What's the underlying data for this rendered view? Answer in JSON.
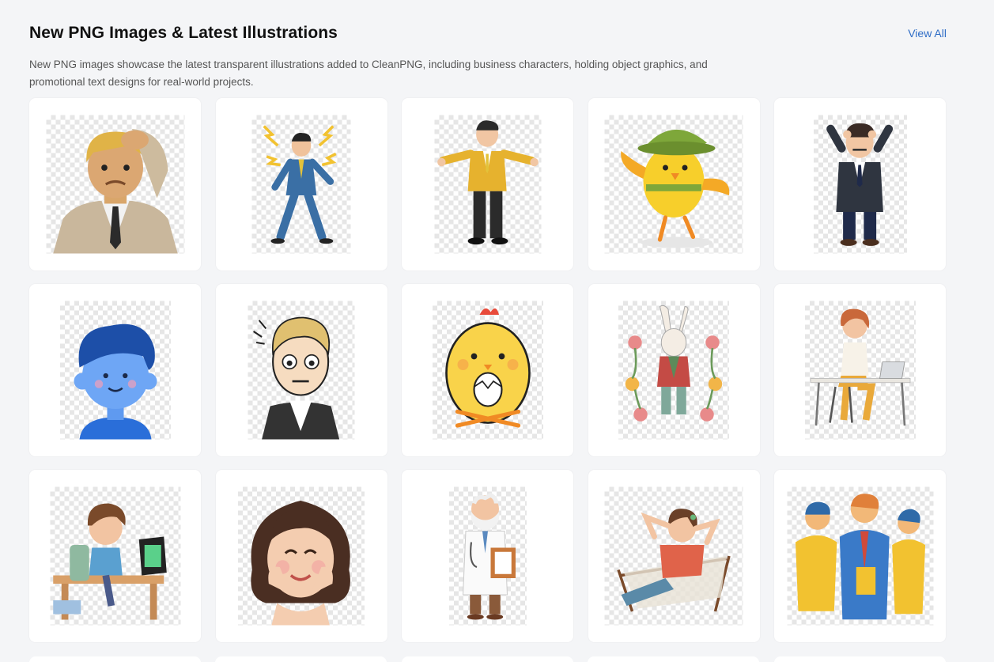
{
  "section": {
    "title": "New PNG Images & Latest Illustrations",
    "view_all_label": "View All",
    "description": "New PNG images showcase the latest transparent illustrations added to CleanPNG, including business characters, holding object graphics, and promotional text designs for real-world projects."
  },
  "images": [
    {
      "icon": "confused-businessman-3d-icon"
    },
    {
      "icon": "stressed-walking-businessman-icon"
    },
    {
      "icon": "shrugging-businessman-icon"
    },
    {
      "icon": "dancing-yellow-chick-icon"
    },
    {
      "icon": "anxious-businessman-icon"
    },
    {
      "icon": "blue-boy-avatar-icon"
    },
    {
      "icon": "worried-cartoon-man-icon"
    },
    {
      "icon": "chick-holding-egg-icon"
    },
    {
      "icon": "floral-rabbit-icon"
    },
    {
      "icon": "woman-at-laptop-icon"
    },
    {
      "icon": "boy-using-tablet-icon"
    },
    {
      "icon": "smiling-girl-portrait-icon"
    },
    {
      "icon": "doctor-with-clipboard-icon"
    },
    {
      "icon": "relaxing-woman-chair-icon"
    },
    {
      "icon": "business-team-discussion-icon"
    }
  ],
  "colors": {
    "page_background": "#f4f5f7",
    "card_background": "#ffffff",
    "link": "#2f6dc6"
  }
}
